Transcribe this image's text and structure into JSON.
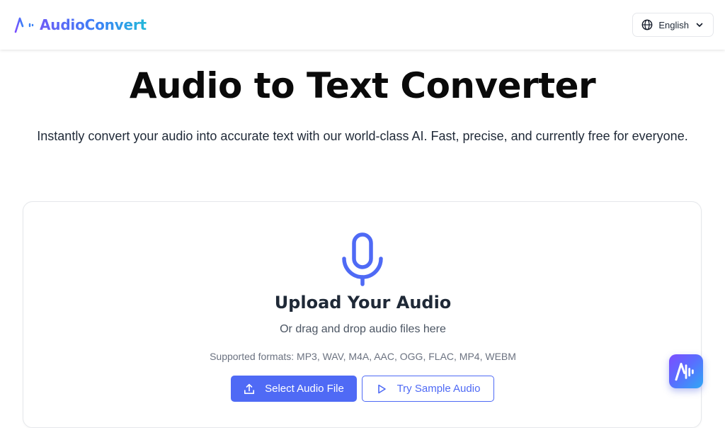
{
  "header": {
    "brand_name": "AudioConvert",
    "logo_icon": "audio-waveform-logo-icon",
    "language": {
      "selected": "English",
      "icon": "globe-icon",
      "dropdown_icon": "chevron-down-icon"
    }
  },
  "hero": {
    "title": "Audio to Text Converter",
    "subtitle": "Instantly convert your audio into accurate text with our world-class AI. Fast, precise, and currently free for everyone."
  },
  "upload": {
    "icon": "microphone-icon",
    "title": "Upload Your Audio",
    "hint": "Or drag and drop audio files here",
    "formats": "Supported formats: MP3, WAV, M4A, AAC, OGG, FLAC, MP4, WEBM",
    "select_button": {
      "label": "Select Audio File",
      "icon": "upload-icon"
    },
    "sample_button": {
      "label": "Try Sample Audio",
      "icon": "play-icon"
    }
  },
  "floating_button": {
    "icon": "audio-waveform-logo-icon"
  },
  "colors": {
    "accent": "#4f6af5",
    "brand_gradient_start": "#6d5cf6",
    "brand_gradient_end": "#22b8d9",
    "title_text": "#0a0a0a",
    "body_text": "#1f2937",
    "muted_text": "#6b7280",
    "card_border": "#e5e7eb"
  }
}
